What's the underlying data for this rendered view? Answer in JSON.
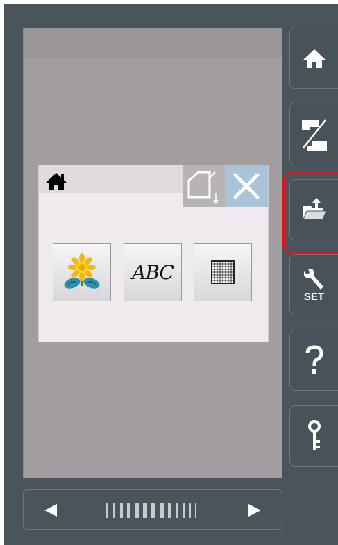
{
  "icons": {
    "dialog_home": "home-icon",
    "hoop": "embroidery-frame-icon",
    "close": "close-icon",
    "pattern_flower": "sunflower-pattern-icon",
    "pattern_grid": "grid-pattern-icon",
    "side_home": "home-icon",
    "side_machine": "sewing-embroidery-switch-icon",
    "side_folder": "folder-upload-icon",
    "side_settings": "wrench-icon",
    "side_help": "question-icon",
    "side_key": "key-icon",
    "scroll_left": "left-arrow-icon",
    "scroll_right": "right-arrow-icon"
  },
  "dialog": {
    "abc_label": "ABC"
  },
  "sidebar": {
    "settings_label": "SET"
  },
  "colors": {
    "frame": "#4a555b",
    "screen": "#a29ea0",
    "dialog_bg": "#eeeaee",
    "close_bg": "#a9c4d8",
    "highlight": "#e0141e"
  }
}
